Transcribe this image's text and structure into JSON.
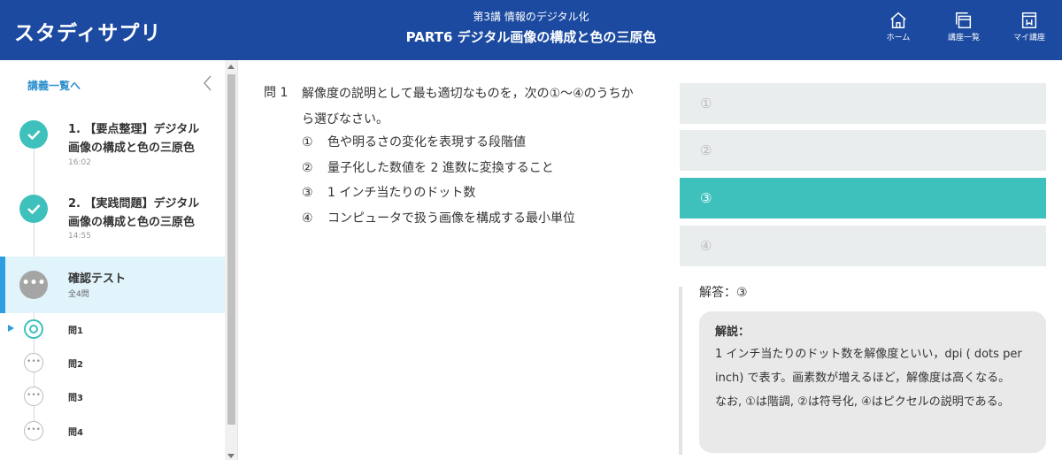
{
  "header": {
    "logo": "スタディサプリ",
    "lecture": "第3講 情報のデジタル化",
    "title": "PART6 デジタル画像の構成と色の三原色",
    "nav": [
      {
        "label": "ホーム",
        "icon": "home-icon"
      },
      {
        "label": "講座一覧",
        "icon": "course-list-icon"
      },
      {
        "label": "マイ講座",
        "icon": "my-course-icon"
      }
    ]
  },
  "sidebar": {
    "back_label": "講義一覧へ",
    "lessons": [
      {
        "title": "1. 【要点整理】デジタル画像の構成と色の三原色",
        "time": "16:02"
      },
      {
        "title": "2. 【実践問題】デジタル画像の構成と色の三原色",
        "time": "14:55"
      }
    ],
    "test": {
      "title": "確認テスト",
      "subtitle": "全4問",
      "dots": "•••"
    },
    "questions": [
      "問1",
      "問2",
      "問3",
      "問4"
    ],
    "q_dots": "•••"
  },
  "question": {
    "number": "問 1",
    "text": "解像度の説明として最も適切なものを，次の①～④のうちから選びなさい。",
    "choices": [
      {
        "num": "①",
        "text": "色や明るさの変化を表現する段階値"
      },
      {
        "num": "②",
        "text": "量子化した数値を 2 進数に変換すること"
      },
      {
        "num": "③",
        "text": "1 インチ当たりのドット数"
      },
      {
        "num": "④",
        "text": "コンピュータで扱う画像を構成する最小単位"
      }
    ]
  },
  "options": [
    "①",
    "②",
    "③",
    "④"
  ],
  "selected_option": 3,
  "answer": {
    "label": "解答：③",
    "explanation_title": "解説：",
    "explanation_1": "1 インチ当たりのドット数を解像度といい，dpi ( dots per inch) で表す。画素数が増えるほど，解像度は高くなる。",
    "explanation_2": "なお, ①は階調, ②は符号化, ④はピクセルの説明である。"
  },
  "colors": {
    "header_bg": "#1b4aa0",
    "accent_teal": "#3ec1bc",
    "active_blue": "#2e9ee0",
    "option_bg": "#e9eded"
  }
}
